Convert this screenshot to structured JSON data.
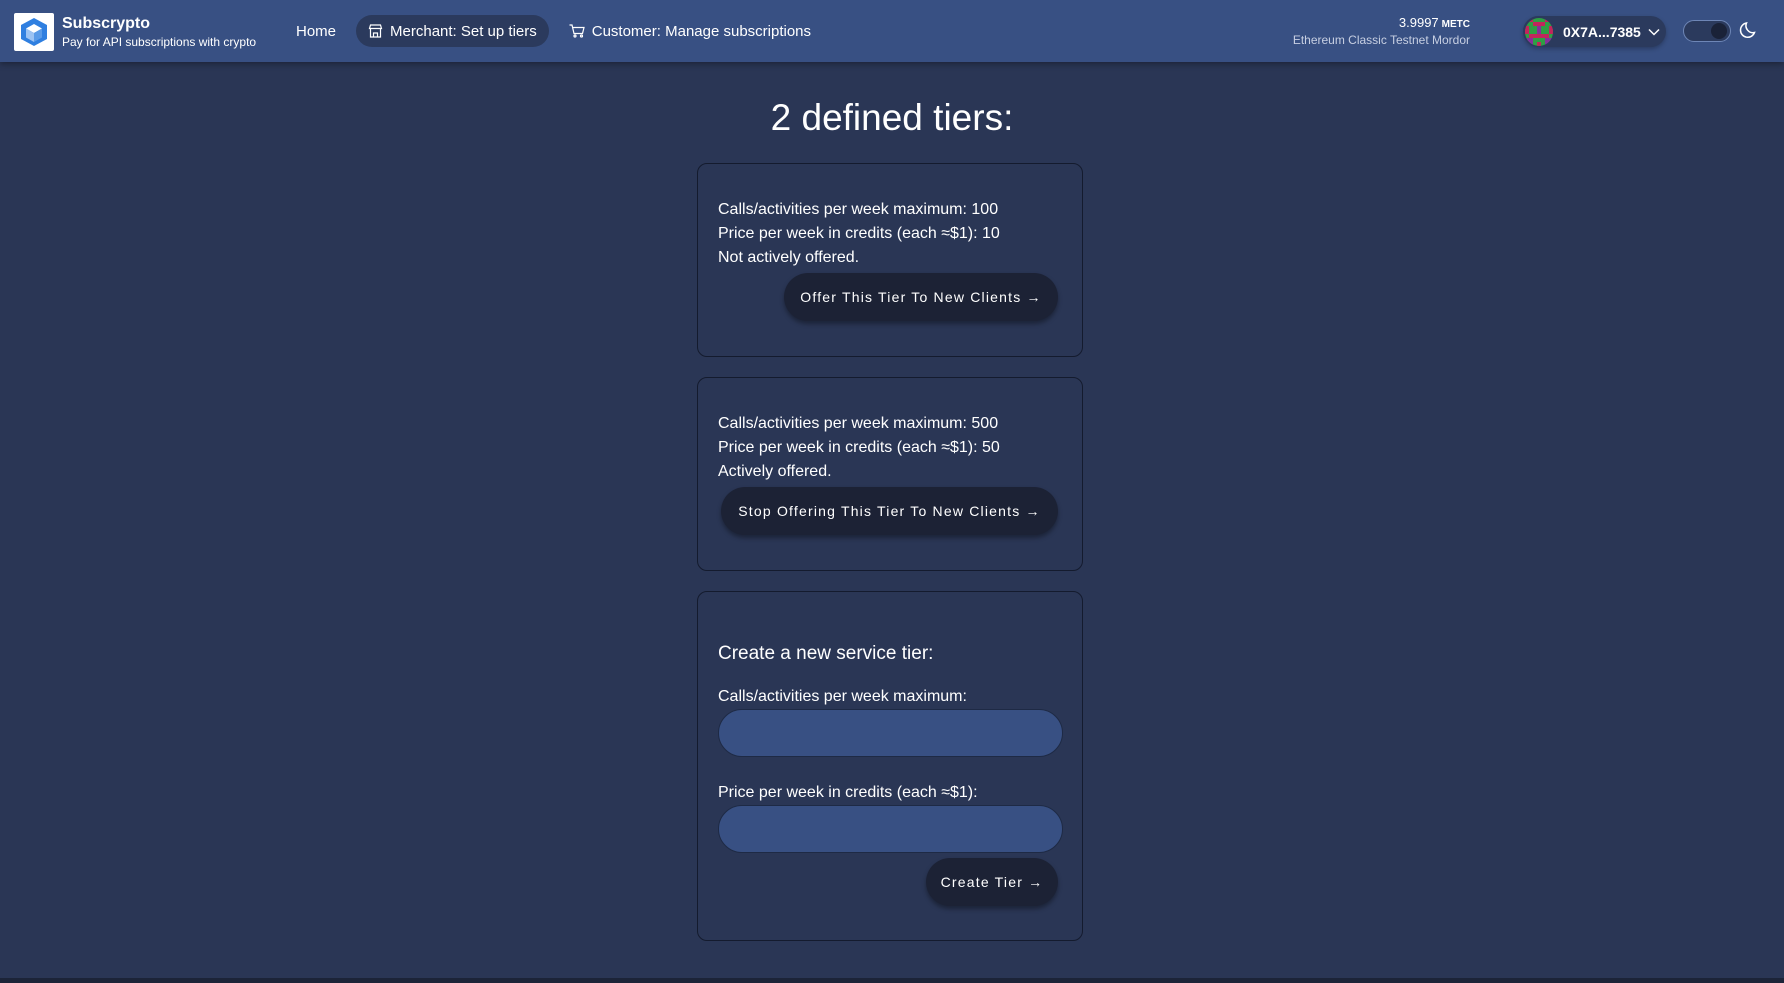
{
  "header": {
    "brand_title": "Subscrypto",
    "brand_subtitle": "Pay for API subscriptions with crypto",
    "logo_icon": "subscrypto-cube-logo",
    "nav": {
      "home": "Home",
      "merchant": "Merchant: Set up tiers",
      "customer": "Customer: Manage subscriptions"
    },
    "nav_active": "merchant",
    "balance_amount": "3.9997",
    "balance_unit": "METC",
    "network": "Ethereum Classic Testnet Mordor",
    "wallet_address": "0X7A...7385",
    "theme": "dark"
  },
  "main": {
    "title": "2 defined tiers:",
    "tiers": [
      {
        "calls_line": "Calls/activities per week maximum: 100",
        "price_line": "Price per week in credits (each ≈$1): 10",
        "status_line": "Not actively offered.",
        "button_label": "Offer This Tier To New Clients →"
      },
      {
        "calls_line": "Calls/activities per week maximum: 500",
        "price_line": "Price per week in credits (each ≈$1): 50",
        "status_line": "Actively offered.",
        "button_label": "Stop Offering This Tier To New Clients →"
      }
    ],
    "create": {
      "title": "Create a new service tier:",
      "calls_label": "Calls/activities per week maximum:",
      "calls_value": "",
      "price_label": "Price per week in credits (each ≈$1):",
      "price_value": "",
      "button_label": "Create Tier →"
    }
  },
  "colors": {
    "background": "#2a3655",
    "header": "#385083",
    "button": "#1c2235",
    "input": "#385083",
    "logo_accent": "#2f7fe0"
  }
}
